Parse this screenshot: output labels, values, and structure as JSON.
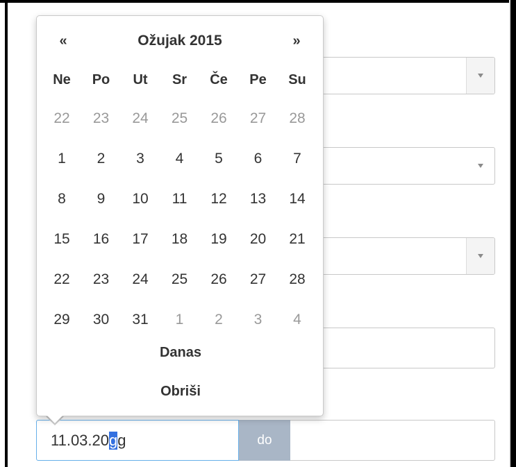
{
  "datepicker": {
    "prev": "«",
    "next": "»",
    "title": "Ožujak 2015",
    "weekdays": [
      "Ne",
      "Po",
      "Ut",
      "Sr",
      "Če",
      "Pe",
      "Su"
    ],
    "weeks": [
      [
        "22",
        "23",
        "24",
        "25",
        "26",
        "27",
        "28"
      ],
      [
        "1",
        "2",
        "3",
        "4",
        "5",
        "6",
        "7"
      ],
      [
        "8",
        "9",
        "10",
        "11",
        "12",
        "13",
        "14"
      ],
      [
        "15",
        "16",
        "17",
        "18",
        "19",
        "20",
        "21"
      ],
      [
        "22",
        "23",
        "24",
        "25",
        "26",
        "27",
        "28"
      ],
      [
        "29",
        "30",
        "31",
        "1",
        "2",
        "3",
        "4"
      ]
    ],
    "muted": [
      [
        true,
        true,
        true,
        true,
        true,
        true,
        true
      ],
      [
        false,
        false,
        false,
        false,
        false,
        false,
        false
      ],
      [
        false,
        false,
        false,
        false,
        false,
        false,
        false
      ],
      [
        false,
        false,
        false,
        false,
        false,
        false,
        false
      ],
      [
        false,
        false,
        false,
        false,
        false,
        false,
        false
      ],
      [
        false,
        false,
        false,
        true,
        true,
        true,
        true
      ]
    ],
    "today_label": "Danas",
    "clear_label": "Obriši"
  },
  "date_range": {
    "from_prefix": "11.03.20",
    "from_selected": "g",
    "from_suffix": "g",
    "separator": "do",
    "to_value": ""
  },
  "colors": {
    "focus_border": "#66afe9",
    "selection": "#3370e0",
    "separator_bg": "#a9b6c6"
  }
}
